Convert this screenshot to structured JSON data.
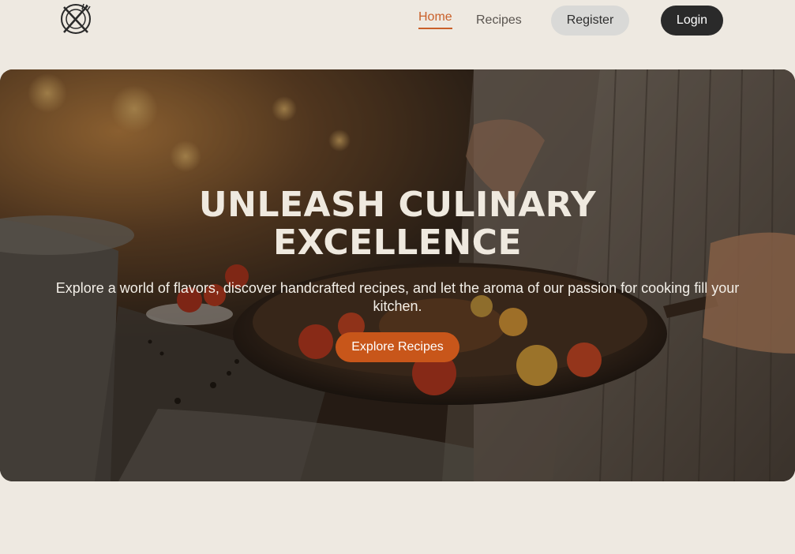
{
  "header": {
    "logo_icon": "plate-fork-knife-icon",
    "nav": {
      "home_label": "Home",
      "recipes_label": "Recipes"
    },
    "register_label": "Register",
    "login_label": "Login"
  },
  "hero": {
    "title_line1": "UNLEASH CULINARY",
    "title_line2": "EXCELLENCE",
    "subtitle": "Explore a world of flavors, discover handcrafted recipes, and let the aroma of our passion for cooking fill your kitchen.",
    "cta_label": "Explore Recipes"
  },
  "colors": {
    "background": "#eee9e1",
    "accent": "#c8561a",
    "nav_active": "#c9602a",
    "login_bg": "#2a2a2a",
    "register_bg": "#d9d9d7"
  }
}
